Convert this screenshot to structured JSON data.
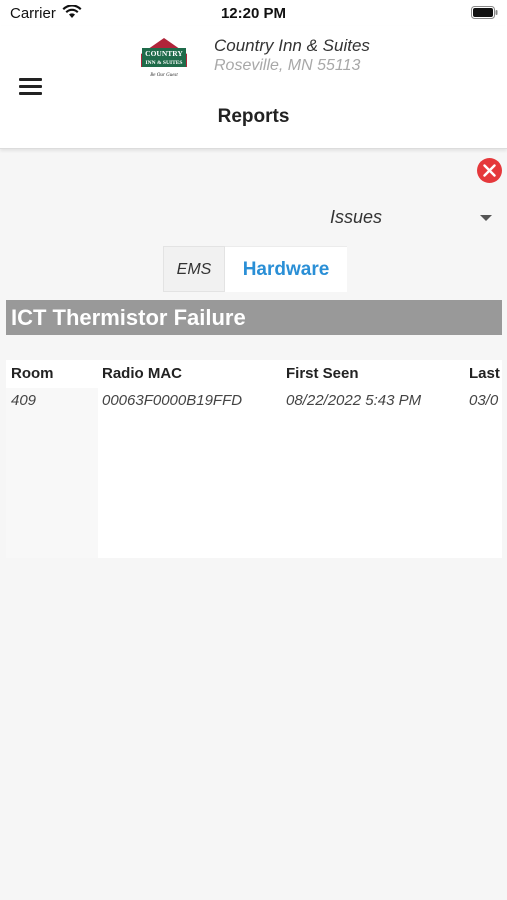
{
  "status_bar": {
    "carrier": "Carrier",
    "time": "12:20 PM"
  },
  "header": {
    "logo_text_top": "COUNTRY",
    "logo_text_bottom": "INN & SUITES",
    "logo_tagline": "Be Our Guest",
    "hotel_name": "Country Inn & Suites",
    "hotel_address": "Roseville, MN 55113",
    "page_title": "Reports"
  },
  "filter": {
    "selected": "Issues"
  },
  "tabs": [
    {
      "label": "EMS",
      "active": false
    },
    {
      "label": "Hardware",
      "active": true
    }
  ],
  "section": {
    "title": "ICT Thermistor Failure",
    "columns": [
      "Room",
      "Radio MAC",
      "First Seen",
      "Last"
    ],
    "rows": [
      [
        "409",
        "00063F0000B19FFD",
        "08/22/2022 5:43 PM",
        "03/0"
      ]
    ]
  },
  "colors": {
    "accent": "#2a8fd6",
    "close": "#e5383b",
    "section_header": "#999999",
    "logo_green": "#1f6b4a",
    "logo_red": "#b0253a"
  },
  "icons": [
    "wifi-icon",
    "battery-icon",
    "menu-icon",
    "close-icon",
    "dropdown-caret-icon"
  ]
}
